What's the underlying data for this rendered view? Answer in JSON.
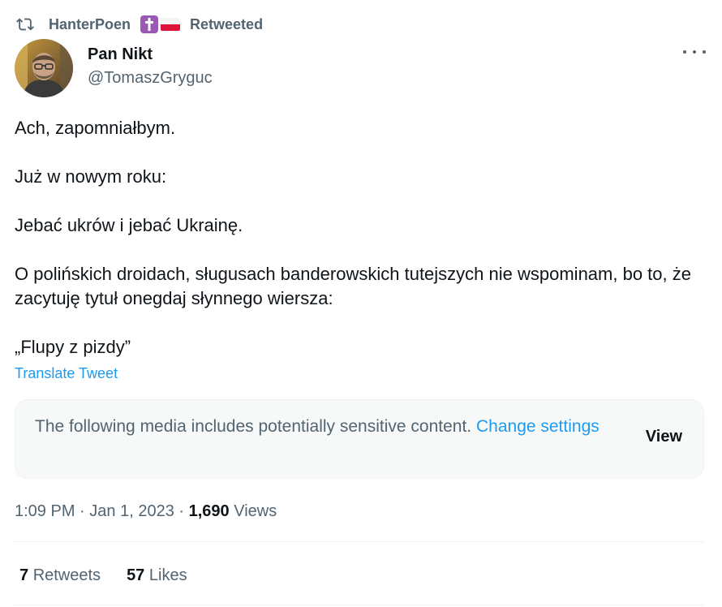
{
  "retweet_bar": {
    "user": "HanterPoen",
    "label": "Retweeted",
    "icons": [
      "retweet-icon",
      "latin-cross-icon",
      "poland-flag-icon"
    ]
  },
  "author": {
    "display_name": "Pan Nikt",
    "handle": "@TomaszGryguc"
  },
  "tweet": {
    "paragraphs": [
      "Ach, zapomniałbym.",
      "Już w nowym roku:",
      "Jebać  ukrów i jebać Ukrainę.",
      "O polińskich droidach, sługusach banderowskich tutejszych nie wspominam, bo to, że zacytuję tytuł onegdaj słynnego wiersza:",
      "„Flupy z pizdy”"
    ],
    "translate_label": "Translate Tweet"
  },
  "sensitive": {
    "message": "The following media includes potentially sensitive content.",
    "link": "Change settings",
    "view_label": "View"
  },
  "meta": {
    "time": "1:09 PM",
    "separator": "·",
    "date": "Jan 1, 2023",
    "views_count": "1,690",
    "views_label": "Views"
  },
  "stats": {
    "retweets_count": "7",
    "retweets_label": "Retweets",
    "likes_count": "57",
    "likes_label": "Likes"
  },
  "colors": {
    "link": "#1d9bf0",
    "secondary_text": "#536471",
    "primary_text": "#0f1419",
    "box_bg": "#f7f9f9",
    "cross_badge": "#9b59b6",
    "flag_red": "#dc143c"
  }
}
